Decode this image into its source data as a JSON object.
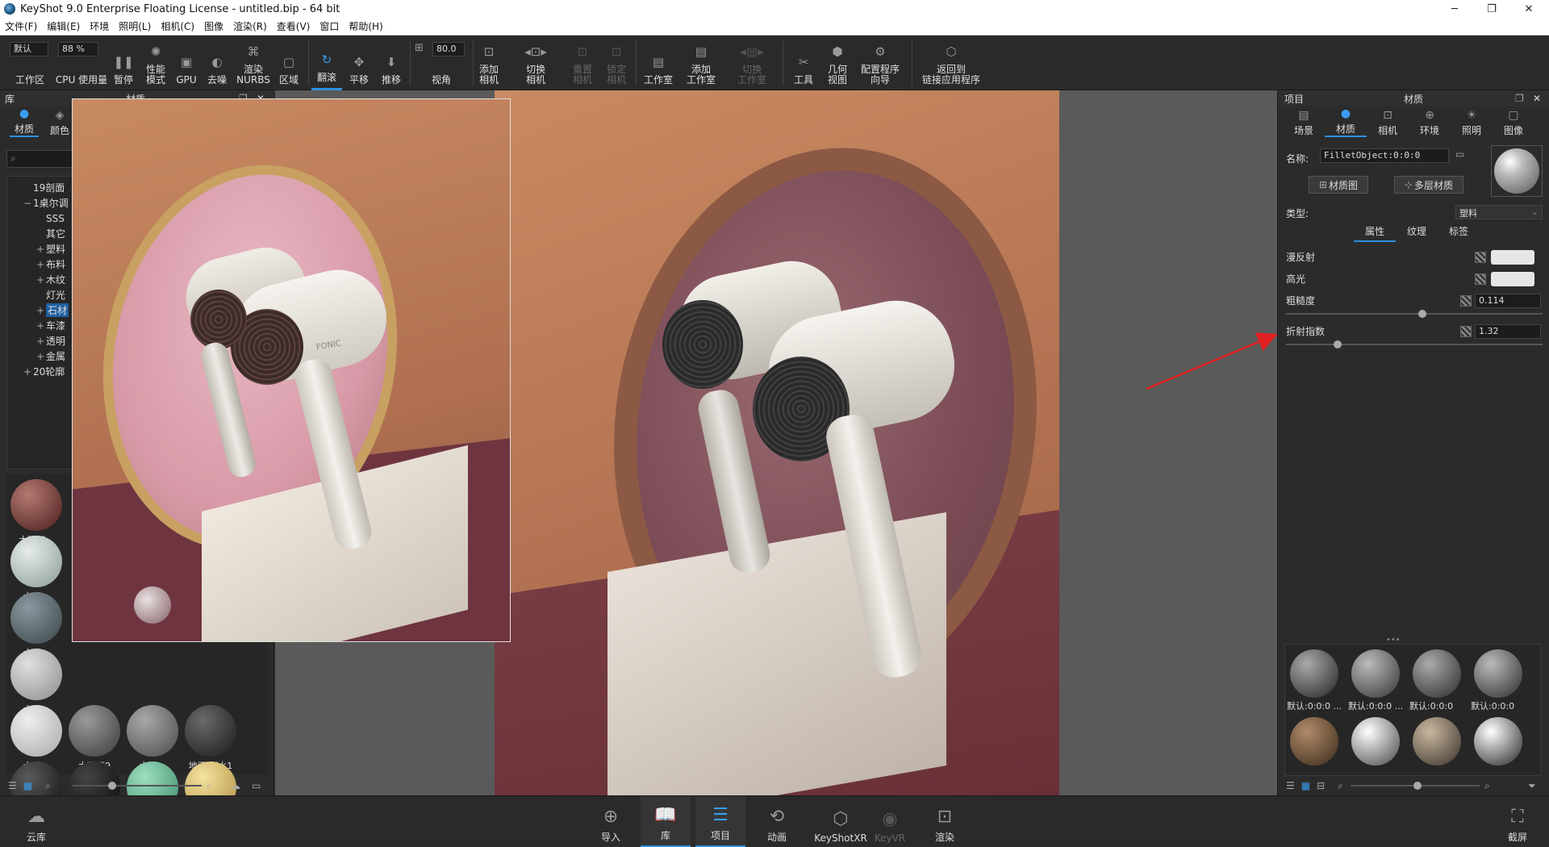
{
  "window": {
    "title": "KeyShot 9.0 Enterprise Floating License  - untitled.bip  - 64 bit",
    "minimize": "─",
    "maximize": "❐",
    "close": "✕"
  },
  "menu": [
    "文件(F)",
    "编辑(E)",
    "环境",
    "照明(L)",
    "相机(C)",
    "图像",
    "渲染(R)",
    "查看(V)",
    "窗口",
    "帮助(H)"
  ],
  "toolbar": {
    "workspace_value": "默认",
    "workspace_label": "工作区",
    "cpu_value": "88 %",
    "cpu_label": "CPU 使用量",
    "pause": "暂停",
    "performance": "性能\n模式",
    "gpu": "GPU",
    "denoise": "去噪",
    "nurbs": "渲染\nNURBS",
    "region": "区域",
    "tumble": "翻滚",
    "pan": "平移",
    "dolly": "推移",
    "fov_value": "80.0",
    "fov_label": "视角",
    "add_camera": "添加\n相机",
    "switch_camera": "切换\n相机",
    "reset_camera": "重置\n相机",
    "lock_camera": "锁定\n相机",
    "studio": "工作室",
    "add_studio": "添加\n工作室",
    "switch_studio": "切换\n工作室",
    "tools": "工具",
    "geometry_view": "几何\n视图",
    "config_wizard": "配置程序\n向导",
    "back_to_linked": "返回到\n链接应用程序"
  },
  "library": {
    "title": "库",
    "subtitle": "材质",
    "tabs": [
      "材质",
      "颜色"
    ],
    "tree": [
      {
        "pm": "",
        "label": "19剖面",
        "indent": 1
      },
      {
        "pm": "−",
        "label": "1桌尔调",
        "indent": 1
      },
      {
        "pm": "",
        "label": "SSS",
        "indent": 2
      },
      {
        "pm": "",
        "label": "其它",
        "indent": 2
      },
      {
        "pm": "+",
        "label": "塑料",
        "indent": 2
      },
      {
        "pm": "+",
        "label": "布料",
        "indent": 2
      },
      {
        "pm": "+",
        "label": "木纹",
        "indent": 2
      },
      {
        "pm": "",
        "label": "灯光",
        "indent": 2
      },
      {
        "pm": "+",
        "label": "石材",
        "indent": 2,
        "selected": true
      },
      {
        "pm": "+",
        "label": "车漆",
        "indent": 2
      },
      {
        "pm": "+",
        "label": "透明",
        "indent": 2
      },
      {
        "pm": "+",
        "label": "金属",
        "indent": 2
      },
      {
        "pm": "+",
        "label": "20轮廓",
        "indent": 1
      }
    ],
    "thumbs": [
      {
        "cap": "大理石...",
        "c1": "#b47a72",
        "c2": "#4a1c1c"
      },
      {
        "cap": "大理...",
        "c1": "#e6ecea",
        "c2": "#8a9a98"
      },
      {
        "cap": "大理...",
        "c1": "#8a98a0",
        "c2": "#3a4448"
      },
      {
        "cap": "大理...",
        "c1": "#e0e0e0",
        "c2": "#8c8c8c"
      },
      {
        "cap": "大理...",
        "c1": "#eeeeee",
        "c2": "#a8a8a8"
      },
      {
        "cap": "大理石9",
        "c1": "#9a9a9a",
        "c2": "#3a3a3a"
      },
      {
        "cap": "大理...",
        "c1": "#a8a8a8",
        "c2": "#4a4a4a"
      },
      {
        "cap": "地面 积水1",
        "c1": "#6a6a6a",
        "c2": "#1a1a1a"
      },
      {
        "cap": "",
        "c1": "#5a5a5a",
        "c2": "#111"
      },
      {
        "cap": "",
        "c1": "#444",
        "c2": "#0a0a0a"
      },
      {
        "cap": "",
        "c1": "#9ee0c0",
        "c2": "#3a8a6a"
      },
      {
        "cap": "",
        "c1": "#f4e2a0",
        "c2": "#b09040"
      }
    ]
  },
  "project": {
    "title": "项目",
    "subtitle": "材质",
    "tabs": [
      "场景",
      "材质",
      "相机",
      "环境",
      "照明",
      "图像"
    ],
    "name_label": "名称:",
    "name_value": "FilletObject:0:0:0",
    "material_graph": "材质图",
    "multi_material": "多层材质",
    "type_label": "类型:",
    "type_value": "塑料",
    "subtabs": [
      "属性",
      "纹理",
      "标签"
    ],
    "props": {
      "diffuse": "漫反射",
      "specular": "高光",
      "roughness": "粗糙度",
      "roughness_value": "0.114",
      "ior": "折射指数",
      "ior_value": "1.32"
    },
    "roughness_fraction": 0.53,
    "ior_fraction": 0.2,
    "swatches": [
      {
        "cap": "默认:0:0:0 ...",
        "c1": "#aaa",
        "c2": "#222"
      },
      {
        "cap": "默认:0:0:0 ...",
        "c1": "#bbb",
        "c2": "#333"
      },
      {
        "cap": "默认:0:0:0",
        "c1": "#aaa",
        "c2": "#2a2a2a"
      },
      {
        "cap": "默认:0:0:0",
        "c1": "#bbb",
        "c2": "#2a2a2a"
      },
      {
        "cap": "",
        "c1": "#b08a6a",
        "c2": "#3a2a1a"
      },
      {
        "cap": "",
        "c1": "#ffffff",
        "c2": "#444"
      },
      {
        "cap": "",
        "c1": "#c8b8a0",
        "c2": "#3a3028"
      },
      {
        "cap": "",
        "c1": "#ffffff",
        "c2": "#222"
      }
    ],
    "more": "•••"
  },
  "viewport": {
    "brand": "FONIC"
  },
  "bottombar": {
    "cloud": "云库",
    "import": "导入",
    "library": "库",
    "project": "项目",
    "animation": "动画",
    "keyshotxr": "KeyShotXR",
    "keyvr": "KeyVR",
    "render": "渲染",
    "screenshot": "截屏"
  },
  "accent": "#2c8fe0"
}
